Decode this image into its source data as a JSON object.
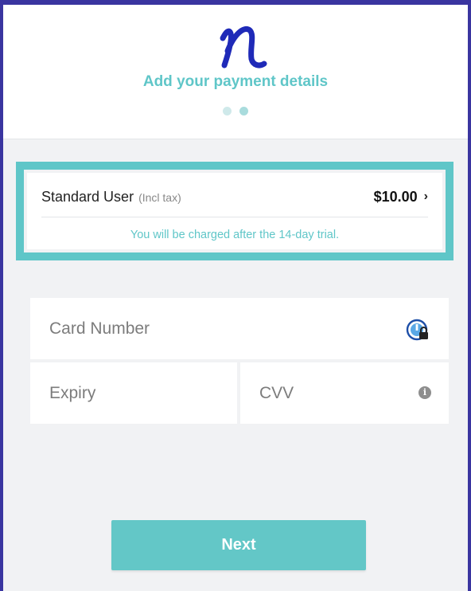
{
  "header": {
    "title": "Add your payment details",
    "steps": [
      {
        "state": "inactive"
      },
      {
        "state": "active"
      }
    ]
  },
  "plan": {
    "name": "Standard User",
    "tax_note": "(Incl tax)",
    "price": "$10.00",
    "chevron": "›",
    "trial_note": "You will be charged after the 14-day trial."
  },
  "card": {
    "number_placeholder": "Card Number",
    "expiry_placeholder": "Expiry",
    "cvv_placeholder": "CVV",
    "cvv_info_glyph": "i"
  },
  "footer": {
    "next_label": "Next"
  },
  "colors": {
    "accent": "#5fc6c8",
    "frame": "#3a35a0",
    "logo": "#1f2ab8"
  },
  "icons": {
    "logo": "n-script-logo",
    "lock": "secure-lock-icon",
    "info": "info-icon",
    "chevron": "chevron-right-icon"
  }
}
